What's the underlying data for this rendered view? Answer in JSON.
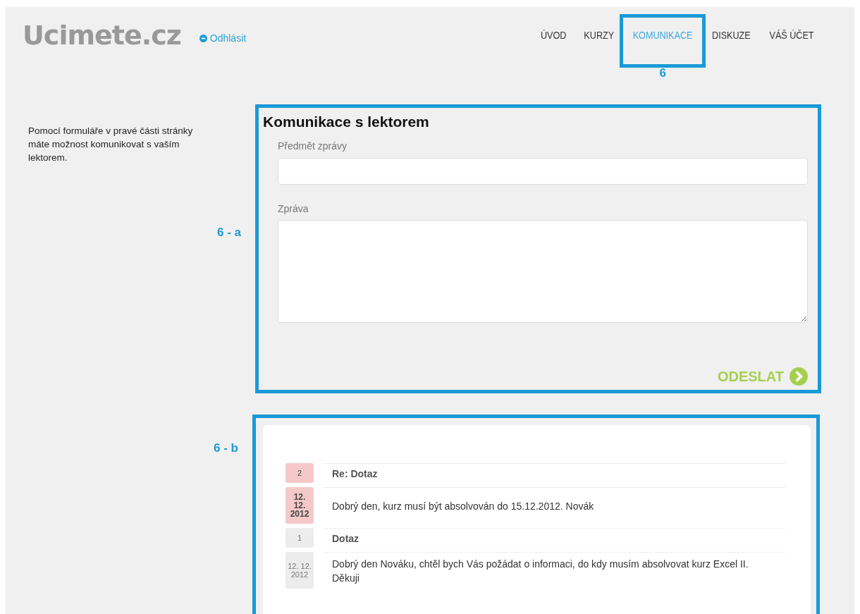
{
  "header": {
    "logo": "Ucimete.cz",
    "logout": "Odhlásit"
  },
  "nav": [
    {
      "label": "ÚVOD",
      "selected": false
    },
    {
      "label": "KURZY",
      "selected": false
    },
    {
      "label": "KOMUNIKACE",
      "selected": true,
      "annotation": "6"
    },
    {
      "label": "DISKUZE",
      "selected": false
    },
    {
      "label": "VÁŠ ÚČET",
      "selected": false
    }
  ],
  "intro": "Pomocí formuláře v pravé části stránky máte možnost komunikovat s vaším lektorem.",
  "form": {
    "annotation": "6 - a",
    "title": "Komunikace s lektorem",
    "subject_label": "Předmět zprávy",
    "message_label": "Zpráva",
    "submit": "ODESLAT"
  },
  "messages": {
    "annotation": "6 - b",
    "threads": [
      {
        "number": "2",
        "subject": "Re: Dotaz",
        "date": [
          "12.",
          "12.",
          "2012"
        ],
        "body": "Dobrý den, kurz musí být absolvován do 15.12.2012. Novák",
        "unread": true
      },
      {
        "number": "1",
        "subject": "Dotaz",
        "date": [
          "12. 12.",
          "2012"
        ],
        "body": "Dobrý den Nováku, chtěl bych Vás požádat o informaci, do kdy musím absolvovat kurz Excel II. Děkuji",
        "unread": false
      }
    ]
  }
}
